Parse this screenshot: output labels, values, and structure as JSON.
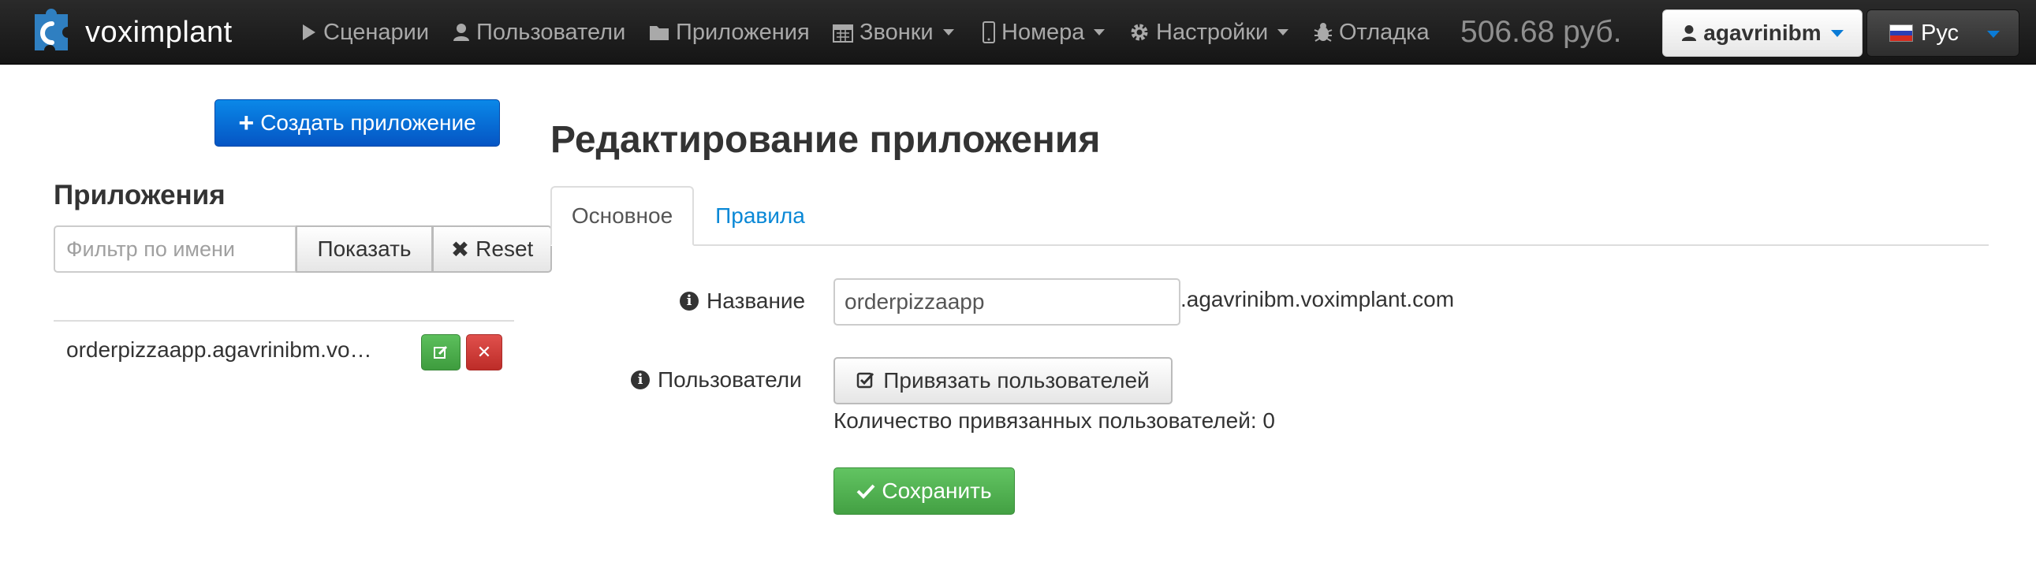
{
  "brand": {
    "name": "voximplant"
  },
  "nav": {
    "items": [
      {
        "label": "Сценарии",
        "icon": "play-icon"
      },
      {
        "label": "Пользователи",
        "icon": "user-icon"
      },
      {
        "label": "Приложения",
        "icon": "folder-icon"
      },
      {
        "label": "Звонки",
        "icon": "calendar-icon",
        "dropdown": true
      },
      {
        "label": "Номера",
        "icon": "mobile-phone-icon",
        "dropdown": true
      },
      {
        "label": "Настройки",
        "icon": "gear-icon",
        "dropdown": true
      },
      {
        "label": "Отладка",
        "icon": "bug-icon"
      }
    ],
    "balance": "506.68 руб.",
    "user": "agavrinibm",
    "language": "Рус"
  },
  "sidebar": {
    "create_button": "Создать приложение",
    "title": "Приложения",
    "filter_placeholder": "Фильтр по имени",
    "show_button": "Показать",
    "reset_button": "Reset",
    "apps": [
      {
        "label": "orderpizzaapp.agavrinibm.vo…"
      }
    ]
  },
  "main": {
    "title": "Редактирование приложения",
    "tabs": [
      {
        "label": "Основное",
        "active": true
      },
      {
        "label": "Правила",
        "active": false
      }
    ],
    "form": {
      "name_label": "Название",
      "name_value": "orderpizzaapp",
      "domain_suffix": ".agavrinibm.voximplant.com",
      "users_label": "Пользователи",
      "bind_users_button": "Привязать пользователей",
      "bound_count_text": "Количество привязанных пользователей: 0",
      "save_button": "Сохранить"
    }
  },
  "colors": {
    "navbar_bg": "#1b1b1b",
    "primary": "#0a6fd8",
    "success": "#4cae4c",
    "danger": "#d43f3a",
    "link": "#0a88d6"
  }
}
